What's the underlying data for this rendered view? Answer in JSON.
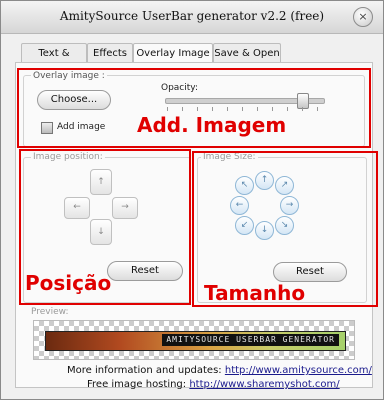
{
  "window": {
    "title": "AmitySource UserBar generator v2.2 (free)",
    "close_glyph": "×"
  },
  "tabs": [
    {
      "label": "Text & Colors"
    },
    {
      "label": "Effects"
    },
    {
      "label": "Overlay Image",
      "active": true
    },
    {
      "label": "Save & Open"
    }
  ],
  "overlay": {
    "group_label": "Overlay image :",
    "choose_label": "Choose...",
    "opacity_label": "Opacity:",
    "opacity_value": 0.9,
    "add_image_label": "Add image",
    "add_image_checked": false
  },
  "position": {
    "label": "Image position:",
    "reset_label": "Reset",
    "arrows": {
      "up": "↑",
      "down": "↓",
      "left": "←",
      "right": "→"
    }
  },
  "size": {
    "label": "Image Size:",
    "reset_label": "Reset",
    "arrows": {
      "up": "↑",
      "down": "↓",
      "left": "←",
      "right": "→",
      "nw": "↖",
      "ne": "↗",
      "sw": "↙",
      "se": "↘"
    }
  },
  "annotations": {
    "add_imagem": "Add. Imagem",
    "posicao": "Posição",
    "tamanho": "Tamanho",
    "color": "#e00000"
  },
  "preview": {
    "label": "Preview:",
    "userbar_text": "AMITYSOURCE USERBAR GENERATOR"
  },
  "footer": {
    "info_label": "More information and updates:",
    "info_link": "http://www.amitysource.com/",
    "hosting_label": "Free image hosting:",
    "hosting_link": "http://www.sharemyshot.com/"
  }
}
